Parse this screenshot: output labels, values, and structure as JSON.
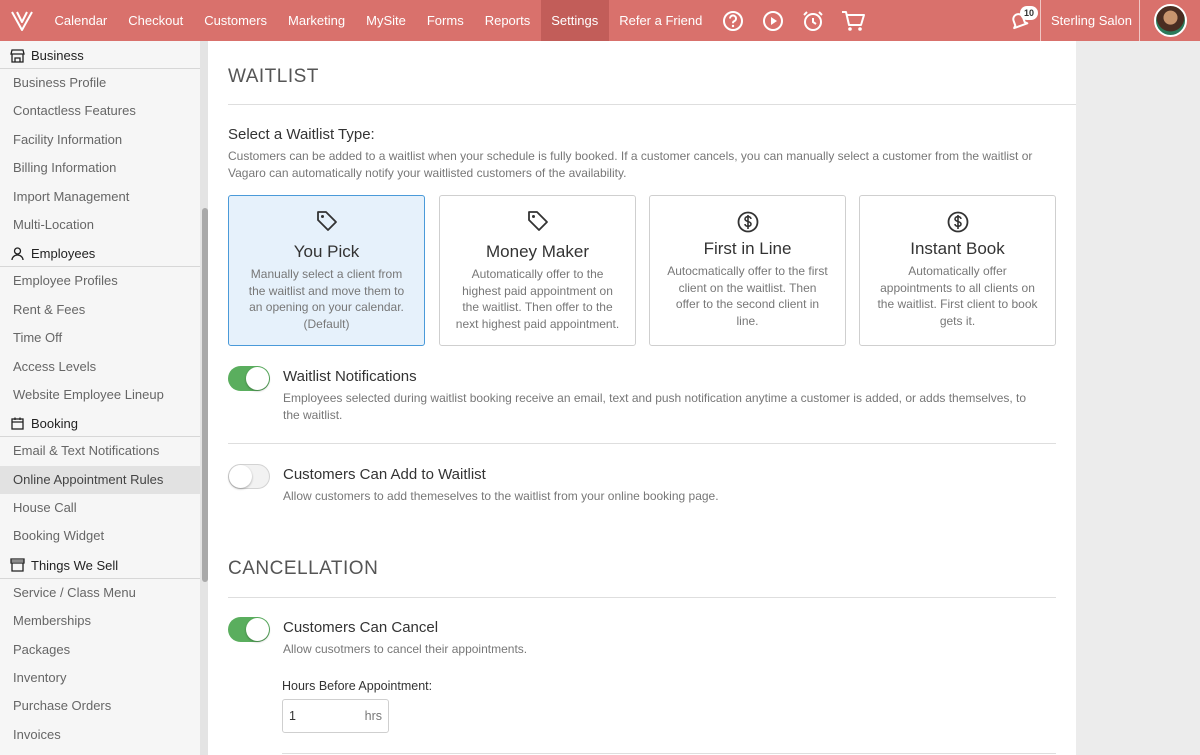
{
  "nav": {
    "items": [
      "Calendar",
      "Checkout",
      "Customers",
      "Marketing",
      "MySite",
      "Forms",
      "Reports",
      "Settings",
      "Refer a Friend"
    ],
    "active": "Settings",
    "icons": [
      "help-icon",
      "play-icon",
      "alarm-clock-icon",
      "cart-icon"
    ],
    "notification_count": "10",
    "account_name": "Sterling Salon",
    "brand_color": "#d9716c"
  },
  "sidebar": {
    "sections": [
      {
        "title": "Business",
        "icon": "store-icon",
        "items": [
          "Business Profile",
          "Contactless Features",
          "Facility Information",
          "Billing Information",
          "Import Management",
          "Multi-Location"
        ]
      },
      {
        "title": "Employees",
        "icon": "person-icon",
        "items": [
          "Employee Profiles",
          "Rent & Fees",
          "Time Off",
          "Access Levels",
          "Website Employee Lineup"
        ]
      },
      {
        "title": "Booking",
        "icon": "calendar-icon",
        "items": [
          "Email & Text Notifications",
          "Online Appointment Rules",
          "House Call",
          "Booking Widget"
        ]
      },
      {
        "title": "Things We Sell",
        "icon": "shop-icon",
        "items": [
          "Service / Class Menu",
          "Memberships",
          "Packages",
          "Inventory",
          "Purchase Orders",
          "Invoices"
        ]
      }
    ],
    "active_item": "Online Appointment Rules"
  },
  "waitlist": {
    "title": "WAITLIST",
    "type_label": "Select a Waitlist Type:",
    "type_desc_line1": "Customers can be added to a waitlist when your schedule is fully booked. If a customer cancels, you can manually select a customer from the waitlist or",
    "type_desc_line2": "Vagaro can automatically notify your waitlisted customers of the availability.",
    "cards": [
      {
        "title": "You Pick",
        "icon": "tag-icon",
        "lines": [
          "Manually select a client from",
          "the waitlist and move them to",
          "an opening on your calendar.",
          "(Default)"
        ],
        "selected": true
      },
      {
        "title": "Money Maker",
        "icon": "tag-icon",
        "lines": [
          "Automatically offer to the",
          "highest paid appointment on",
          "the waitlist. Then offer to the",
          "next highest paid appointment."
        ],
        "selected": false
      },
      {
        "title": "First in Line",
        "icon": "dollar-circle-icon",
        "lines": [
          "Autocmatically offer to the first",
          "client on the waitlist. Then",
          "offer to the second client in",
          "line."
        ],
        "selected": false
      },
      {
        "title": "Instant Book",
        "icon": "dollar-circle-icon",
        "lines": [
          "Automatically offer",
          "appointments to all clients on",
          "the waitlist. First client to book",
          "gets it."
        ],
        "selected": false
      }
    ],
    "notifications": {
      "title": "Waitlist Notifications",
      "desc_line1": "Employees selected during waitlist booking receive an email, text and push notification anytime a customer is added, or adds themselves, to",
      "desc_line2": "the waitlist.",
      "enabled": true
    },
    "customers_add": {
      "title": "Customers Can Add to Waitlist",
      "desc": "Allow customers to add themeselves to the waitlist from your online booking page.",
      "enabled": false
    }
  },
  "cancellation": {
    "title": "CANCELLATION",
    "customers_cancel": {
      "title": "Customers Can Cancel",
      "desc": "Allow cusotmers to cancel their appointments.",
      "enabled": true
    },
    "hours_label": "Hours Before Appointment:",
    "hours_value": "1",
    "hours_unit": "hrs"
  },
  "colors": {
    "toggle_on": "#5aae5e",
    "selected_card_bg": "#e6f1fb",
    "selected_card_border": "#4a9ad9"
  }
}
